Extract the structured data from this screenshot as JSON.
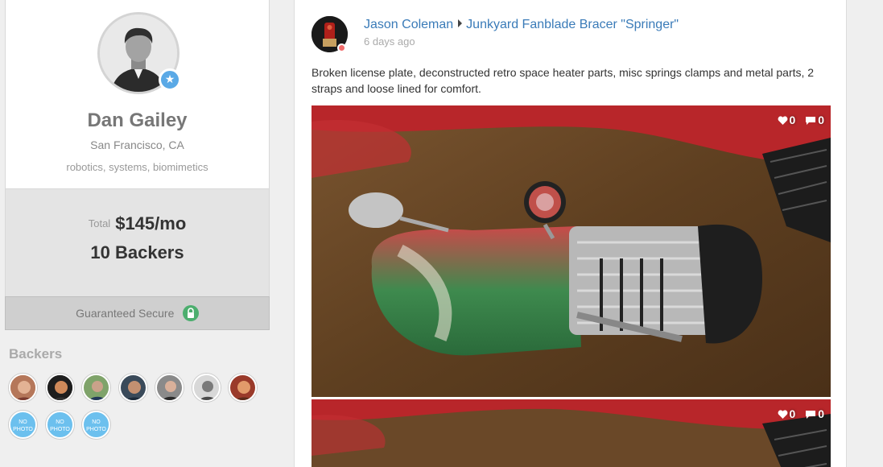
{
  "profile": {
    "name": "Dan Gailey",
    "location": "San Francisco, CA",
    "tags": "robotics, systems, biomimetics",
    "avatar_badge": "star-icon"
  },
  "totals": {
    "label": "Total",
    "amount": "$145/mo",
    "backers": "10 Backers"
  },
  "secure": {
    "label": "Guaranteed Secure",
    "icon": "lock-icon"
  },
  "backers": {
    "heading": "Backers",
    "no_photo_label": "NO PHOTO",
    "photo_count": 7,
    "no_photo_count": 3
  },
  "post": {
    "author": "Jason Coleman",
    "project": "Junkyard Fanblade Bracer \"Springer\"",
    "time": "6 days ago",
    "body": "Broken license plate, deconstructed retro space heater parts, misc springs clamps and metal parts, 2 straps and loose lined for comfort.",
    "photos": [
      {
        "likes": "0",
        "comments": "0"
      },
      {
        "likes": "0",
        "comments": "0"
      }
    ]
  },
  "colors": {
    "link": "#3a7bb8",
    "badge_blue": "#5aa9e6",
    "secure_green": "#4cae6e",
    "online_dot": "#f26b6b",
    "no_photo_blue": "#6cc0ee"
  }
}
